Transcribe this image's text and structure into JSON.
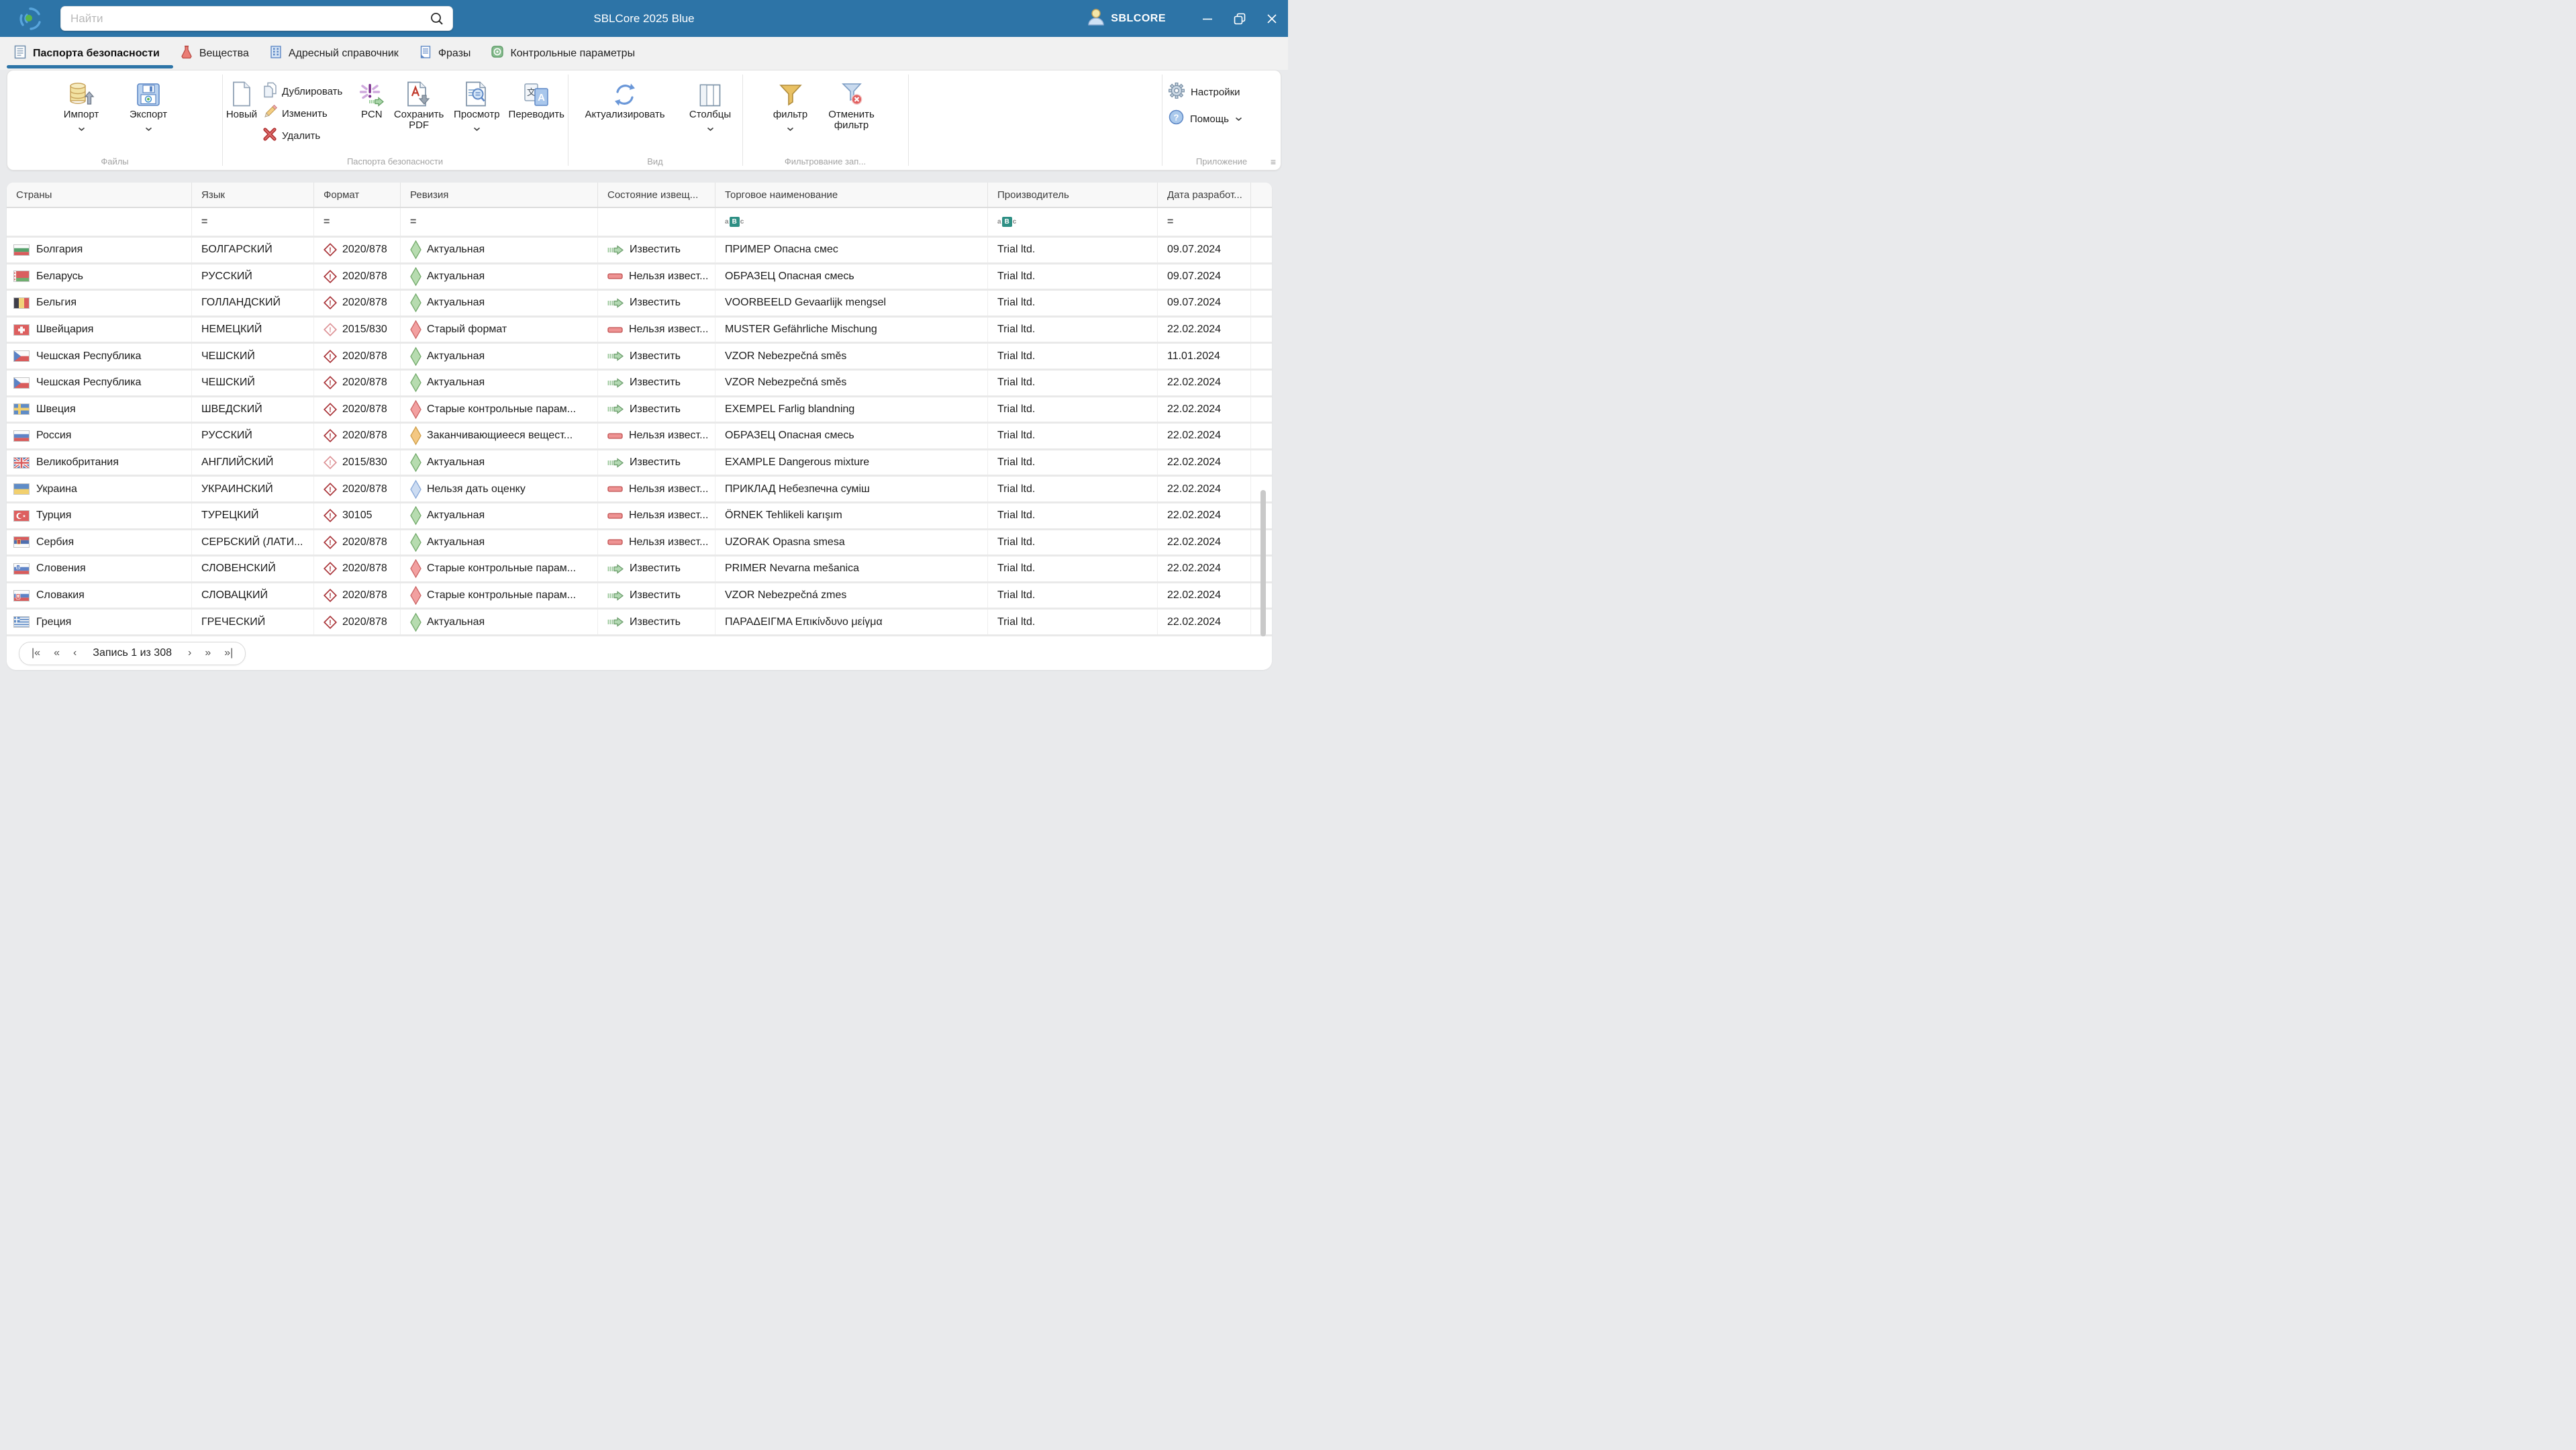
{
  "window": {
    "title": "SBLCore 2025 Blue",
    "user": "SBLCORE",
    "search_placeholder": "Найти"
  },
  "tabs": [
    {
      "label": "Паспорта безопасности",
      "active": true
    },
    {
      "label": "Вещества",
      "active": false
    },
    {
      "label": "Адресный справочник",
      "active": false
    },
    {
      "label": "Фразы",
      "active": false
    },
    {
      "label": "Контрольные параметры",
      "active": false
    }
  ],
  "ribbon": {
    "files": {
      "label": "Файлы",
      "import": "Импорт",
      "export": "Экспорт"
    },
    "sds": {
      "label": "Паспорта безопасности",
      "new": "Новый",
      "duplicate": "Дублировать",
      "edit": "Изменить",
      "delete": "Удалить",
      "pcn": "PCN",
      "save_pdf": "Сохранить PDF",
      "preview": "Просмотр",
      "translate": "Переводить"
    },
    "view": {
      "label": "Вид",
      "refresh": "Актуализировать",
      "columns": "Столбцы"
    },
    "filtering": {
      "label": "Фильтрование зап...",
      "filter": "фильтр",
      "cancel_filter": "Отменить фильтр"
    },
    "app": {
      "label": "Приложение",
      "settings": "Настройки",
      "help": "Помощь"
    }
  },
  "table": {
    "columns": [
      "Страны",
      "Язык",
      "Формат",
      "Ревизия",
      "Состояние извещ...",
      "Торговое наименование",
      "Производитель",
      "Дата разработ..."
    ],
    "filters": {
      "language": "=",
      "format": "=",
      "revision": "=",
      "trade_name": "aBc",
      "manufacturer": "aBc",
      "date": "="
    },
    "rows": [
      {
        "country": "Болгария",
        "flag": "bg",
        "language": "БОЛГАРСКИЙ",
        "format": "2020/878",
        "format_light": false,
        "revision": "Актуальная",
        "revision_color": "green",
        "notify": "Известить",
        "notify_type": "go",
        "trade_name": "ПРИМЕР Опасна смес",
        "manufacturer": "Trial ltd.",
        "date": "09.07.2024"
      },
      {
        "country": "Беларусь",
        "flag": "by",
        "language": "РУССКИЙ",
        "format": "2020/878",
        "format_light": false,
        "revision": "Актуальная",
        "revision_color": "green",
        "notify": "Нельзя извест...",
        "notify_type": "stop",
        "trade_name": "ОБРАЗЕЦ Опасная смесь",
        "manufacturer": "Trial ltd.",
        "date": "09.07.2024"
      },
      {
        "country": "Бельгия",
        "flag": "be",
        "language": "ГОЛЛАНДСКИЙ",
        "format": "2020/878",
        "format_light": false,
        "revision": "Актуальная",
        "revision_color": "green",
        "notify": "Известить",
        "notify_type": "go",
        "trade_name": "VOORBEELD Gevaarlijk mengsel",
        "manufacturer": "Trial ltd.",
        "date": "09.07.2024"
      },
      {
        "country": "Швейцария",
        "flag": "ch",
        "language": "НЕМЕЦКИЙ",
        "format": "2015/830",
        "format_light": true,
        "revision": "Старый формат",
        "revision_color": "red",
        "notify": "Нельзя извест...",
        "notify_type": "stop",
        "trade_name": "MUSTER Gefährliche Mischung",
        "manufacturer": "Trial ltd.",
        "date": "22.02.2024"
      },
      {
        "country": "Чешская Республика",
        "flag": "cz",
        "language": "ЧЕШСКИЙ",
        "format": "2020/878",
        "format_light": false,
        "revision": "Актуальная",
        "revision_color": "green",
        "notify": "Известить",
        "notify_type": "go",
        "trade_name": "VZOR Nebezpečná směs",
        "manufacturer": "Trial ltd.",
        "date": "11.01.2024"
      },
      {
        "country": "Чешская Республика",
        "flag": "cz",
        "language": "ЧЕШСКИЙ",
        "format": "2020/878",
        "format_light": false,
        "revision": "Актуальная",
        "revision_color": "green",
        "notify": "Известить",
        "notify_type": "go",
        "trade_name": "VZOR Nebezpečná směs",
        "manufacturer": "Trial ltd.",
        "date": "22.02.2024"
      },
      {
        "country": "Швеция",
        "flag": "se",
        "language": "ШВЕДСКИЙ",
        "format": "2020/878",
        "format_light": false,
        "revision": "Старые контрольные парам...",
        "revision_color": "red",
        "notify": "Известить",
        "notify_type": "go",
        "trade_name": "EXEMPEL Farlig blandning",
        "manufacturer": "Trial ltd.",
        "date": "22.02.2024"
      },
      {
        "country": "Россия",
        "flag": "ru",
        "language": "РУССКИЙ",
        "format": "2020/878",
        "format_light": false,
        "revision": "Заканчивающиееся вещест...",
        "revision_color": "orange",
        "notify": "Нельзя извест...",
        "notify_type": "stop",
        "trade_name": "ОБРАЗЕЦ Опасная смесь",
        "manufacturer": "Trial ltd.",
        "date": "22.02.2024"
      },
      {
        "country": "Великобритания",
        "flag": "gb",
        "language": "АНГЛИЙСКИЙ",
        "format": "2015/830",
        "format_light": true,
        "revision": "Актуальная",
        "revision_color": "green",
        "notify": "Известить",
        "notify_type": "go",
        "trade_name": "EXAMPLE Dangerous mixture",
        "manufacturer": "Trial ltd.",
        "date": "22.02.2024"
      },
      {
        "country": "Украина",
        "flag": "ua",
        "language": "УКРАИНСКИЙ",
        "format": "2020/878",
        "format_light": false,
        "revision": "Нельзя дать оценку",
        "revision_color": "blue",
        "notify": "Нельзя извест...",
        "notify_type": "stop",
        "trade_name": "ПРИКЛАД Небезпечна суміш",
        "manufacturer": "Trial ltd.",
        "date": "22.02.2024"
      },
      {
        "country": "Турция",
        "flag": "tr",
        "language": "ТУРЕЦКИЙ",
        "format": "30105",
        "format_light": false,
        "revision": "Актуальная",
        "revision_color": "green",
        "notify": "Нельзя извест...",
        "notify_type": "stop",
        "trade_name": "ÖRNEK Tehlikeli karışım",
        "manufacturer": "Trial ltd.",
        "date": "22.02.2024"
      },
      {
        "country": "Сербия",
        "flag": "rs",
        "language": "СЕРБСКИЙ (ЛАТИ...",
        "format": "2020/878",
        "format_light": false,
        "revision": "Актуальная",
        "revision_color": "green",
        "notify": "Нельзя извест...",
        "notify_type": "stop",
        "trade_name": "UZORAK Opasna smesa",
        "manufacturer": "Trial ltd.",
        "date": "22.02.2024"
      },
      {
        "country": "Словения",
        "flag": "si",
        "language": "СЛОВЕНСКИЙ",
        "format": "2020/878",
        "format_light": false,
        "revision": "Старые контрольные парам...",
        "revision_color": "red",
        "notify": "Известить",
        "notify_type": "go",
        "trade_name": "PRIMER Nevarna mešanica",
        "manufacturer": "Trial ltd.",
        "date": "22.02.2024"
      },
      {
        "country": "Словакия",
        "flag": "sk",
        "language": "СЛОВАЦКИЙ",
        "format": "2020/878",
        "format_light": false,
        "revision": "Старые контрольные парам...",
        "revision_color": "red",
        "notify": "Известить",
        "notify_type": "go",
        "trade_name": "VZOR Nebezpečná zmes",
        "manufacturer": "Trial ltd.",
        "date": "22.02.2024"
      },
      {
        "country": "Греция",
        "flag": "gr",
        "language": "ГРЕЧЕСКИЙ",
        "format": "2020/878",
        "format_light": false,
        "revision": "Актуальная",
        "revision_color": "green",
        "notify": "Известить",
        "notify_type": "go",
        "trade_name": "ΠΑΡΑΔΕΙΓΜΑ Επικίνδυνο μείγμα",
        "manufacturer": "Trial ltd.",
        "date": "22.02.2024"
      }
    ]
  },
  "pagination": {
    "first": "|«",
    "fast_prev": "«",
    "prev": "‹",
    "label": "Запись 1 из 308",
    "next": "›",
    "fast_next": "»",
    "last": "»|"
  },
  "colors": {
    "accent": "#2d74a7",
    "abc_teal": "#2e8f84"
  }
}
